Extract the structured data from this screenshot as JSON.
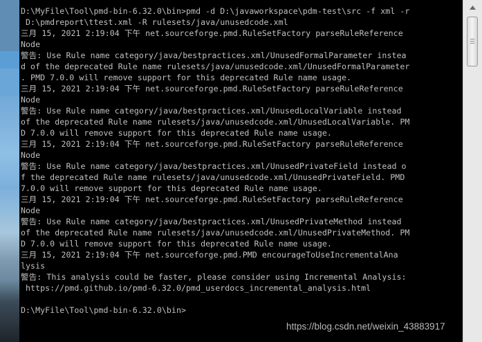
{
  "console": {
    "lines": [
      "D:\\MyFile\\Tool\\pmd-bin-6.32.0\\bin>pmd -d D:\\javaworkspace\\pdm-test\\src -f xml -r",
      " D:\\pmdreport\\ttest.xml -R rulesets/java/unusedcode.xml",
      "三月 15, 2021 2:19:04 下午 net.sourceforge.pmd.RuleSetFactory parseRuleReference",
      "Node",
      "警告: Use Rule name category/java/bestpractices.xml/UnusedFormalParameter instea",
      "d of the deprecated Rule name rulesets/java/unusedcode.xml/UnusedFormalParameter",
      ". PMD 7.0.0 will remove support for this deprecated Rule name usage.",
      "三月 15, 2021 2:19:04 下午 net.sourceforge.pmd.RuleSetFactory parseRuleReference",
      "Node",
      "警告: Use Rule name category/java/bestpractices.xml/UnusedLocalVariable instead",
      "of the deprecated Rule name rulesets/java/unusedcode.xml/UnusedLocalVariable. PM",
      "D 7.0.0 will remove support for this deprecated Rule name usage.",
      "三月 15, 2021 2:19:04 下午 net.sourceforge.pmd.RuleSetFactory parseRuleReference",
      "Node",
      "警告: Use Rule name category/java/bestpractices.xml/UnusedPrivateField instead o",
      "f the deprecated Rule name rulesets/java/unusedcode.xml/UnusedPrivateField. PMD",
      "7.0.0 will remove support for this deprecated Rule name usage.",
      "三月 15, 2021 2:19:04 下午 net.sourceforge.pmd.RuleSetFactory parseRuleReference",
      "Node",
      "警告: Use Rule name category/java/bestpractices.xml/UnusedPrivateMethod instead",
      "of the deprecated Rule name rulesets/java/unusedcode.xml/UnusedPrivateMethod. PM",
      "D 7.0.0 will remove support for this deprecated Rule name usage.",
      "三月 15, 2021 2:19:04 下午 net.sourceforge.pmd.PMD encourageToUseIncrementalAna",
      "lysis",
      "警告: This analysis could be faster, please consider using Incremental Analysis:",
      " https://pmd.github.io/pmd-6.32.0/pmd_userdocs_incremental_analysis.html",
      "",
      "D:\\MyFile\\Tool\\pmd-bin-6.32.0\\bin>"
    ]
  },
  "scrollbar": {
    "up_arrow_icon": "triangle-up-icon"
  },
  "watermark": {
    "text": "https://blog.csdn.net/weixin_43883917"
  }
}
